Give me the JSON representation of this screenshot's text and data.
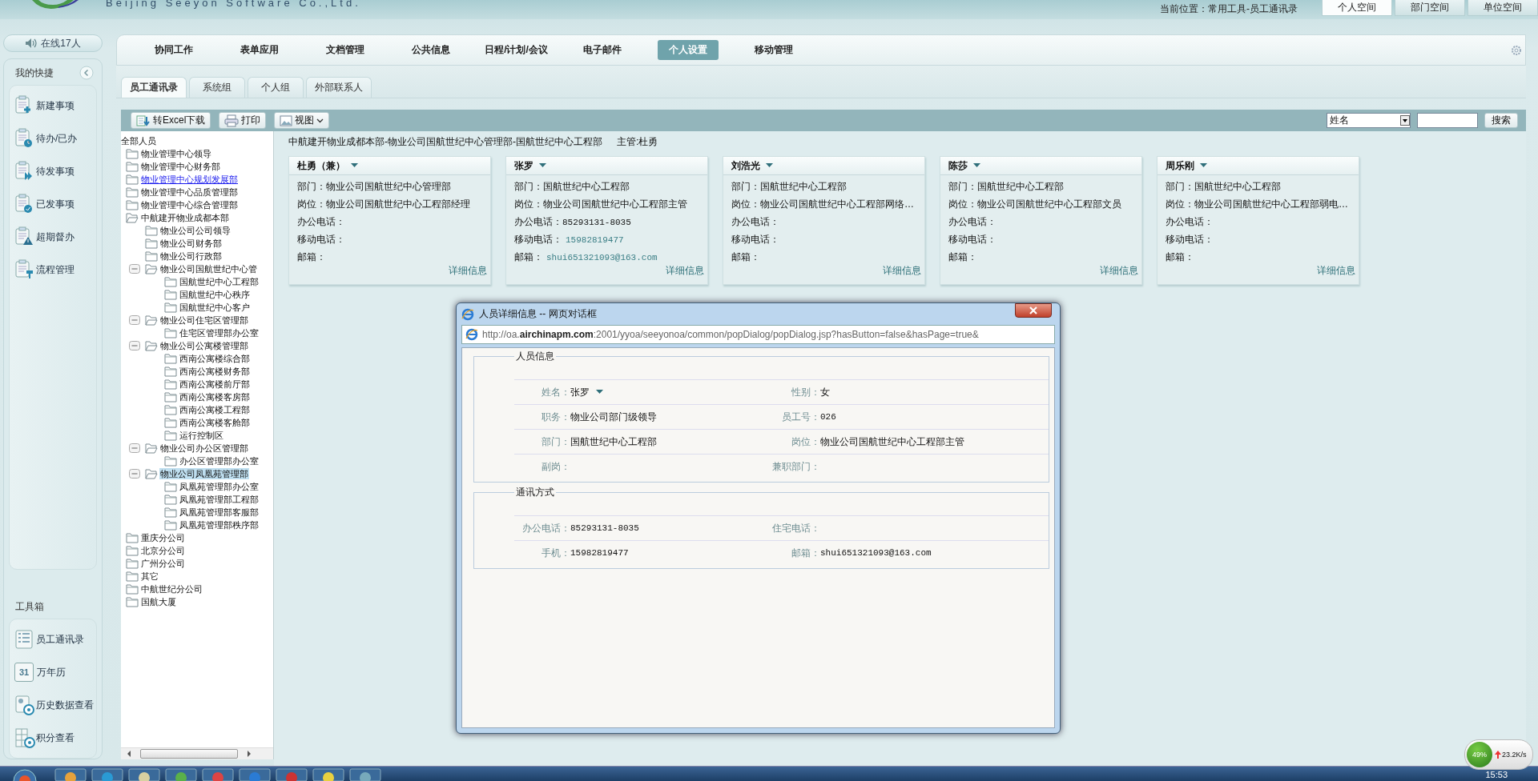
{
  "header": {
    "logo_text": "Beijing Seeyon Software Co.,Ltd.",
    "location": "当前位置：常用工具-员工通讯录",
    "space_tabs": [
      {
        "label": "个人空间",
        "selected": true
      },
      {
        "label": "部门空间",
        "selected": false
      },
      {
        "label": "单位空间",
        "selected": false
      }
    ]
  },
  "sidebar": {
    "online": "在线17人",
    "shortcuts_title": "我的快捷",
    "shortcuts": [
      {
        "label": "新建事项"
      },
      {
        "label": "待办/已办"
      },
      {
        "label": "待发事项"
      },
      {
        "label": "已发事项"
      },
      {
        "label": "超期督办"
      },
      {
        "label": "流程管理"
      }
    ],
    "toolbox_title": "工具箱",
    "toolbox": [
      {
        "label": "员工通讯录"
      },
      {
        "label": "万年历",
        "icon_text": "31"
      },
      {
        "label": "历史数据查看"
      },
      {
        "label": "积分查看"
      }
    ]
  },
  "nav": [
    {
      "label": "协同工作",
      "selected": false
    },
    {
      "label": "表单应用",
      "selected": false
    },
    {
      "label": "文档管理",
      "selected": false
    },
    {
      "label": "公共信息",
      "selected": false
    },
    {
      "label": "日程/计划/会议",
      "selected": false
    },
    {
      "label": "电子邮件",
      "selected": false
    },
    {
      "label": "个人设置",
      "selected": true
    },
    {
      "label": "移动管理",
      "selected": false
    }
  ],
  "sub_tabs": [
    {
      "label": "员工通讯录",
      "selected": true
    },
    {
      "label": "系统组",
      "selected": false
    },
    {
      "label": "个人组",
      "selected": false
    },
    {
      "label": "外部联系人",
      "selected": false
    }
  ],
  "toolbar": {
    "buttons": [
      "转Excel下载",
      "打印"
    ],
    "view": "视图",
    "search_field": "姓名",
    "search_button": "搜索"
  },
  "tree": {
    "root": "全部人员",
    "children": [
      {
        "label": "物业管理中心领导",
        "selected": false,
        "hovered": false
      },
      {
        "label": "物业管理中心财务部",
        "selected": false,
        "hovered": false
      },
      {
        "label": "物业管理中心规划发展部",
        "selected": false,
        "hovered": true
      },
      {
        "label": "物业管理中心品质管理部",
        "selected": false,
        "hovered": false
      },
      {
        "label": "物业管理中心综合管理部",
        "selected": false,
        "hovered": false
      },
      {
        "label": "中航建开物业成都本部",
        "selected": false,
        "hovered": false,
        "expanded": true,
        "children": [
          {
            "label": "物业公司公司领导",
            "selected": false,
            "hovered": false
          },
          {
            "label": "物业公司财务部",
            "selected": false,
            "hovered": false
          },
          {
            "label": "物业公司行政部",
            "selected": false,
            "hovered": false
          },
          {
            "label": "物业公司国航世纪中心管",
            "selected": false,
            "hovered": false,
            "expanded": true,
            "children": [
              {
                "label": "国航世纪中心工程部",
                "selected": false,
                "hovered": false
              },
              {
                "label": "国航世纪中心秩序",
                "selected": false,
                "hovered": false
              },
              {
                "label": "国航世纪中心客户",
                "selected": false,
                "hovered": false
              }
            ]
          },
          {
            "label": "物业公司住宅区管理部",
            "selected": false,
            "hovered": false,
            "expanded": true,
            "children": [
              {
                "label": "住宅区管理部办公室",
                "selected": false,
                "hovered": false
              }
            ]
          },
          {
            "label": "物业公司公寓楼管理部",
            "selected": false,
            "hovered": false,
            "expanded": true,
            "children": [
              {
                "label": "西南公寓楼综合部",
                "selected": false,
                "hovered": false
              },
              {
                "label": "西南公寓楼财务部",
                "selected": false,
                "hovered": false
              },
              {
                "label": "西南公寓楼前厅部",
                "selected": false,
                "hovered": false
              },
              {
                "label": "西南公寓楼客房部",
                "selected": false,
                "hovered": false
              },
              {
                "label": "西南公寓楼工程部",
                "selected": false,
                "hovered": false
              },
              {
                "label": "西南公寓楼客舱部",
                "selected": false,
                "hovered": false
              },
              {
                "label": "运行控制区",
                "selected": false,
                "hovered": false
              }
            ]
          },
          {
            "label": "物业公司办公区管理部",
            "selected": false,
            "hovered": false,
            "expanded": true,
            "children": [
              {
                "label": "办公区管理部办公室",
                "selected": false,
                "hovered": false
              }
            ]
          },
          {
            "label": "物业公司凤凰苑管理部",
            "selected": true,
            "hovered": false,
            "expanded": true,
            "children": [
              {
                "label": "凤凰苑管理部办公室",
                "selected": false,
                "hovered": false
              },
              {
                "label": "凤凰苑管理部工程部",
                "selected": false,
                "hovered": false
              },
              {
                "label": "凤凰苑管理部客服部",
                "selected": false,
                "hovered": false
              },
              {
                "label": "凤凰苑管理部秩序部",
                "selected": false,
                "hovered": false
              }
            ]
          }
        ]
      },
      {
        "label": "重庆分公司",
        "selected": false,
        "hovered": false
      },
      {
        "label": "北京分公司",
        "selected": false,
        "hovered": false
      },
      {
        "label": "广州分公司",
        "selected": false,
        "hovered": false
      },
      {
        "label": "其它",
        "selected": false,
        "hovered": false
      },
      {
        "label": "中航世纪分公司",
        "selected": false,
        "hovered": false
      },
      {
        "label": "国航大厦",
        "selected": false,
        "hovered": false
      }
    ]
  },
  "breadcrumb": {
    "path": "中航建开物业成都本部-物业公司国航世纪中心管理部-国航世纪中心工程部",
    "supervisor": "主管:杜勇"
  },
  "cards": [
    {
      "name": "杜勇（兼）",
      "fields": [
        {
          "label": "部门：",
          "value": "物业公司国航世纪中心管理部",
          "link": false
        },
        {
          "label": "岗位：",
          "value": "物业公司国航世纪中心工程部经理",
          "link": false
        },
        {
          "label": "办公电话："
        },
        {
          "label": "移动电话："
        },
        {
          "label": "邮箱："
        }
      ],
      "link": "详细信息"
    },
    {
      "name": "张罗",
      "fields": [
        {
          "label": "部门：",
          "value": "国航世纪中心工程部",
          "link": false
        },
        {
          "label": "岗位：",
          "value": "物业公司国航世纪中心工程部主管",
          "link": false
        },
        {
          "label": "办公电话：",
          "value": "85293131-8035",
          "link": false,
          "mono": true
        },
        {
          "label": "移动电话：",
          "value": "15982819477",
          "link": true,
          "mono": true
        },
        {
          "label": "邮箱：",
          "value": "shui651321093@163.com",
          "link": true,
          "mono": true
        }
      ],
      "link": "详细信息"
    },
    {
      "name": "刘浩光",
      "fields": [
        {
          "label": "部门：",
          "value": "国航世纪中心工程部",
          "link": false
        },
        {
          "label": "岗位：",
          "value": "物业公司国航世纪中心工程部网络…",
          "link": false
        },
        {
          "label": "办公电话："
        },
        {
          "label": "移动电话："
        },
        {
          "label": "邮箱："
        }
      ],
      "link": "详细信息"
    },
    {
      "name": "陈莎",
      "fields": [
        {
          "label": "部门：",
          "value": "国航世纪中心工程部",
          "link": false
        },
        {
          "label": "岗位：",
          "value": "物业公司国航世纪中心工程部文员",
          "link": false
        },
        {
          "label": "办公电话："
        },
        {
          "label": "移动电话："
        },
        {
          "label": "邮箱："
        }
      ],
      "link": "详细信息"
    },
    {
      "name": "周乐刚",
      "fields": [
        {
          "label": "部门：",
          "value": "国航世纪中心工程部",
          "link": false
        },
        {
          "label": "岗位：",
          "value": "物业公司国航世纪中心工程部弱电…",
          "link": false
        },
        {
          "label": "办公电话："
        },
        {
          "label": "移动电话："
        },
        {
          "label": "邮箱："
        }
      ],
      "link": "详细信息"
    }
  ],
  "dialog": {
    "title": "人员详细信息 -- 网页对话框",
    "url": "http://oa.**airchinapm.com**:2001/yyoa/seeyonoa/common/popDialog/popDialog.jsp?hasButton=false&hasPage=true&",
    "sections": [
      {
        "title": "人员信息",
        "rows": [
          {
            "cells": [
              {
                "label": "姓名：",
                "value": "张罗",
                "dropdown": true
              },
              {
                "label": "性别：",
                "value": "女"
              }
            ]
          },
          {
            "cells": [
              {
                "label": "职务：",
                "value": "物业公司部门级领导"
              },
              {
                "label": "员工号：",
                "value": "026",
                "mono": true
              }
            ]
          },
          {
            "cells": [
              {
                "label": "部门：",
                "value": "国航世纪中心工程部"
              },
              {
                "label": "岗位：",
                "value": "物业公司国航世纪中心工程部主管"
              }
            ]
          },
          {
            "cells": [
              {
                "label": "副岗："
              },
              {
                "label": "兼职部门："
              }
            ]
          }
        ]
      },
      {
        "title": "通讯方式",
        "rows": [
          {
            "cells": [
              {
                "label": "办公电话：",
                "value": "85293131-8035",
                "mono": true
              },
              {
                "label": "住宅电话："
              }
            ]
          },
          {
            "cells": [
              {
                "label": "手机：",
                "value": "15982819477",
                "mono": true
              },
              {
                "label": "邮箱：",
                "value": "shui651321093@163.com",
                "mono": true
              }
            ]
          }
        ]
      }
    ]
  },
  "net_widget": {
    "cpu": "49%",
    "upload": "23.2K/s"
  },
  "taskbar": {
    "clock": "15:53"
  }
}
